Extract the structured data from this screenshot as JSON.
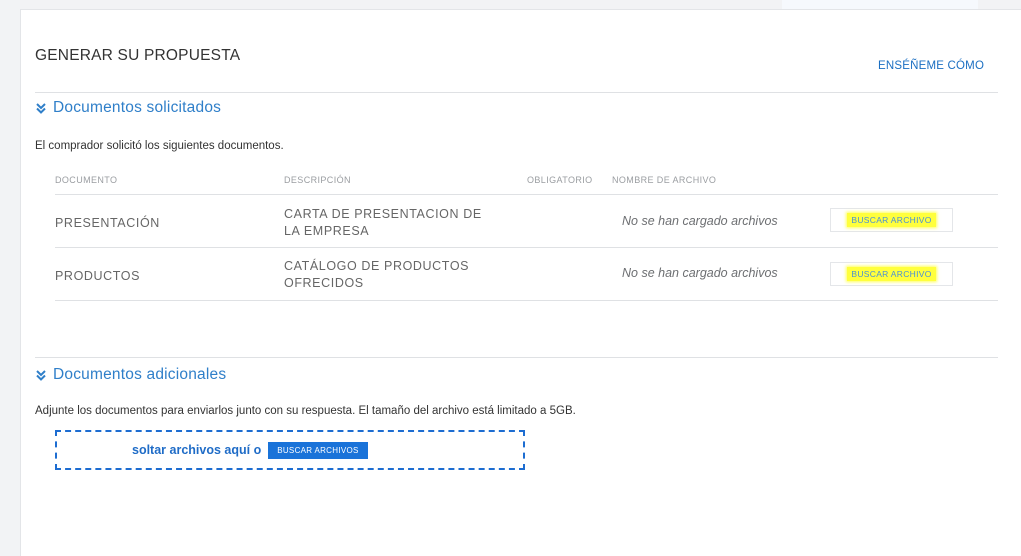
{
  "header": {
    "title": "GENERAR SU PROPUESTA",
    "help_link": "ENSÉÑEME CÓMO"
  },
  "requested": {
    "heading": "Documentos solicitados",
    "intro": "El comprador solicitó los siguientes documentos.",
    "columns": [
      "DOCUMENTO",
      "DESCRIPCIÓN",
      "OBLIGATORIO",
      "NOMBRE DE ARCHIVO"
    ],
    "rows": [
      {
        "document": "PRESENTACIÓN",
        "description_line1": "CARTA DE PRESENTACION DE",
        "description_line2": "LA EMPRESA",
        "file_status": "No se han cargado archivos",
        "button": "BUSCAR ARCHIVO"
      },
      {
        "document": "PRODUCTOS",
        "description_line1": "CATÁLOGO DE PRODUCTOS",
        "description_line2": "OFRECIDOS",
        "file_status": "No se han cargado archivos",
        "button": "BUSCAR ARCHIVO"
      }
    ]
  },
  "additional": {
    "heading": "Documentos adicionales",
    "intro": "Adjunte los documentos para enviarlos junto con su respuesta. El tamaño del archivo está limitado a 5GB.",
    "drop_text": "soltar archivos aquí o",
    "browse_button": "BUSCAR ARCHIVOS"
  },
  "colors": {
    "accent": "#2f7fc9",
    "highlight": "#ffff3c",
    "dropzone_border": "#1d6dd1",
    "button_blue": "#1a73d9"
  },
  "icons": {
    "section_toggle": "chevron-double-down-icon"
  }
}
